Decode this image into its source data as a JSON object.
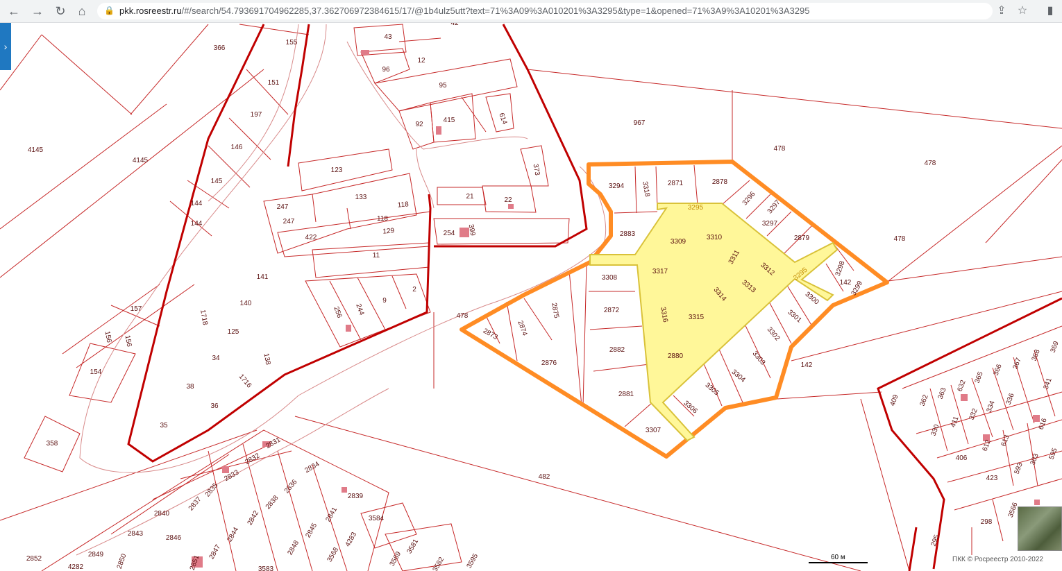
{
  "browser": {
    "back": "←",
    "forward": "→",
    "reload": "↻",
    "home": "⌂",
    "url_domain": "pkk.rosreestr.ru",
    "url_rest": "/#/search/54.793691704962285,37.362706972384615/17/@1b4ulz5utt?text=71%3A09%3A010201%3A3295&type=1&opened=71%3A9%3A10201%3A3295",
    "share": "⇪",
    "star": "☆",
    "panel": "▮"
  },
  "sidebar_toggle": "›",
  "map": {
    "parcels": [
      "366",
      "155",
      "43",
      "42",
      "96",
      "12",
      "151",
      "95",
      "197",
      "92",
      "415",
      "614",
      "967",
      "478",
      "478",
      "4145",
      "4145",
      "146",
      "123",
      "373",
      "145",
      "133",
      "21",
      "22",
      "247",
      "247",
      "144",
      "144",
      "118",
      "118",
      "422",
      "129",
      "254",
      "399",
      "11",
      "141",
      "140",
      "157",
      "1718",
      "478",
      "256",
      "244",
      "9",
      "2",
      "125",
      "156",
      "156",
      "34",
      "138",
      "154",
      "1716",
      "38",
      "36",
      "35",
      "358",
      "3294",
      "3318",
      "2871",
      "2878",
      "3296",
      "3297",
      "3297",
      "2883",
      "3309",
      "3310",
      "2879",
      "3311",
      "3312",
      "3308",
      "3317",
      "3313",
      "3314",
      "3298",
      "3299",
      "3300",
      "3301",
      "2872",
      "3316",
      "3315",
      "3302",
      "2875",
      "2874",
      "2873",
      "2882",
      "2880",
      "3303",
      "2876",
      "3304",
      "3305",
      "3306",
      "2881",
      "3307",
      "478",
      "142",
      "142",
      "482",
      "409",
      "362",
      "363",
      "632",
      "365",
      "366",
      "367",
      "368",
      "369",
      "341",
      "330",
      "411",
      "332",
      "334",
      "336",
      "616",
      "406",
      "613",
      "612",
      "593",
      "303",
      "595",
      "423",
      "298",
      "295",
      "2831",
      "2832",
      "2833",
      "2834",
      "2835",
      "2836",
      "2837",
      "2838",
      "2839",
      "2840",
      "2841",
      "2842",
      "2843",
      "2844",
      "2845",
      "2846",
      "2847",
      "2848",
      "2849",
      "2850",
      "2851",
      "2852",
      "4282",
      "4283",
      "3568",
      "3569",
      "3581",
      "3582",
      "3583",
      "3584",
      "3595",
      "3566",
      "300"
    ],
    "selected_label_1": "3295",
    "selected_label_2": "3295",
    "scale_label": "60 м",
    "copyright": "ПКК © Росреестр 2010-2022"
  }
}
